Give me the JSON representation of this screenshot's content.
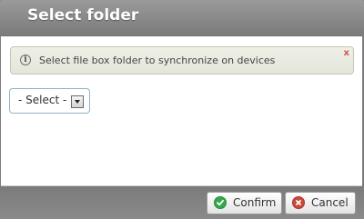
{
  "dialog": {
    "title": "Select folder"
  },
  "info": {
    "icon": "info-icon",
    "text": "Select file box folder to synchronize on devices",
    "close_label": "x"
  },
  "folder_select": {
    "selected": "- Select -"
  },
  "footer": {
    "confirm_label": "Confirm",
    "cancel_label": "Cancel"
  },
  "colors": {
    "confirm_icon": "#36a84a",
    "cancel_icon": "#cc4a3b",
    "close_icon": "#d9534f"
  }
}
